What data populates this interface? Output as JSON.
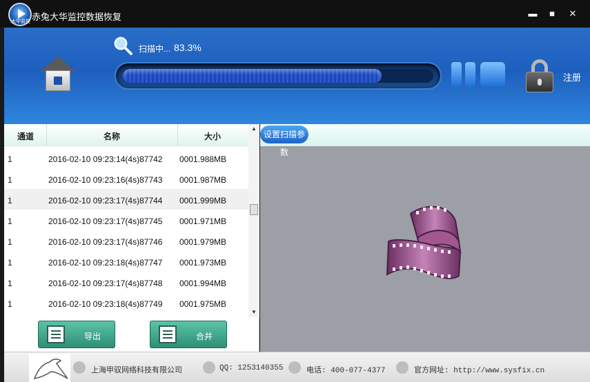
{
  "window": {
    "title": "赤兔大华监控数据恢复",
    "logo_text": "大华监控",
    "minimize": "▬",
    "maximize": "■",
    "close": "✕"
  },
  "scan": {
    "status_label": "扫描中...",
    "percent_text": "83.3%",
    "progress": 0.833
  },
  "header": {
    "register_label": "注册"
  },
  "table": {
    "columns": [
      "通道",
      "名称",
      "大小"
    ],
    "rows": [
      {
        "channel": "1",
        "name": "2016-02-10 09:23:14(4s)87742",
        "size": "0001.988MB"
      },
      {
        "channel": "1",
        "name": "2016-02-10 09:23:16(4s)87743",
        "size": "0001.987MB"
      },
      {
        "channel": "1",
        "name": "2016-02-10 09:23:17(4s)87744",
        "size": "0001.999MB"
      },
      {
        "channel": "1",
        "name": "2016-02-10 09:23:17(4s)87745",
        "size": "0001.971MB"
      },
      {
        "channel": "1",
        "name": "2016-02-10 09:23:17(4s)87746",
        "size": "0001.979MB"
      },
      {
        "channel": "1",
        "name": "2016-02-10 09:23:18(4s)87747",
        "size": "0001.973MB"
      },
      {
        "channel": "1",
        "name": "2016-02-10 09:23:17(4s)87748",
        "size": "0001.994MB"
      },
      {
        "channel": "1",
        "name": "2016-02-10 09:23:18(4s)87749",
        "size": "0001.975MB"
      }
    ]
  },
  "actions": {
    "export_label": "导出",
    "merge_label": "合并"
  },
  "preview": {
    "settings_button": "设置扫描参数"
  },
  "footer": {
    "company": "上海甲驭网络科技有限公司",
    "qq": "QQ: 1253140355",
    "phone": "电话: 400-077-4377",
    "website": "官方网址: http://www.sysfix.cn"
  },
  "colors": {
    "header_blue": "#2a6ec8",
    "button_teal": "#2e8f75",
    "preview_gray": "#9d9fa6",
    "film_magenta": "#9b4f8e"
  }
}
